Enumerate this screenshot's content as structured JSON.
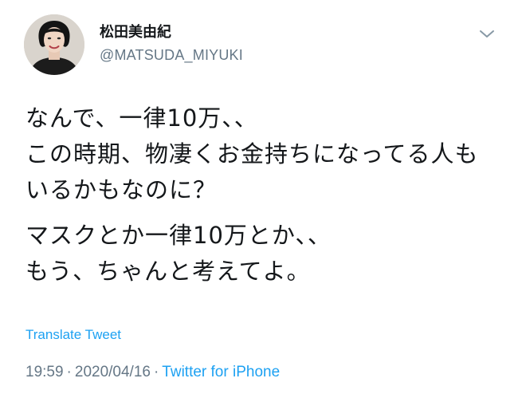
{
  "author": {
    "display_name": "松田美由紀",
    "handle": "@MATSUDA_MIYUKI"
  },
  "tweet": {
    "paragraphs": [
      {
        "lines": [
          "なんで、一律10万、、",
          "この時期、物凄くお金持ちになってる人も",
          "いるかもなのに？"
        ]
      },
      {
        "lines": [
          "マスクとか一律10万とか、、",
          "もう、ちゃんと考えてよ。"
        ]
      }
    ],
    "translate_label": "Translate Tweet",
    "time": "19:59",
    "date": "2020/04/16",
    "source": "Twitter for iPhone",
    "separator": "·"
  },
  "icons": {
    "menu": "chevron-down-icon"
  },
  "colors": {
    "text": "#14171a",
    "secondary": "#657786",
    "link": "#1da1f2",
    "background": "#ffffff"
  }
}
